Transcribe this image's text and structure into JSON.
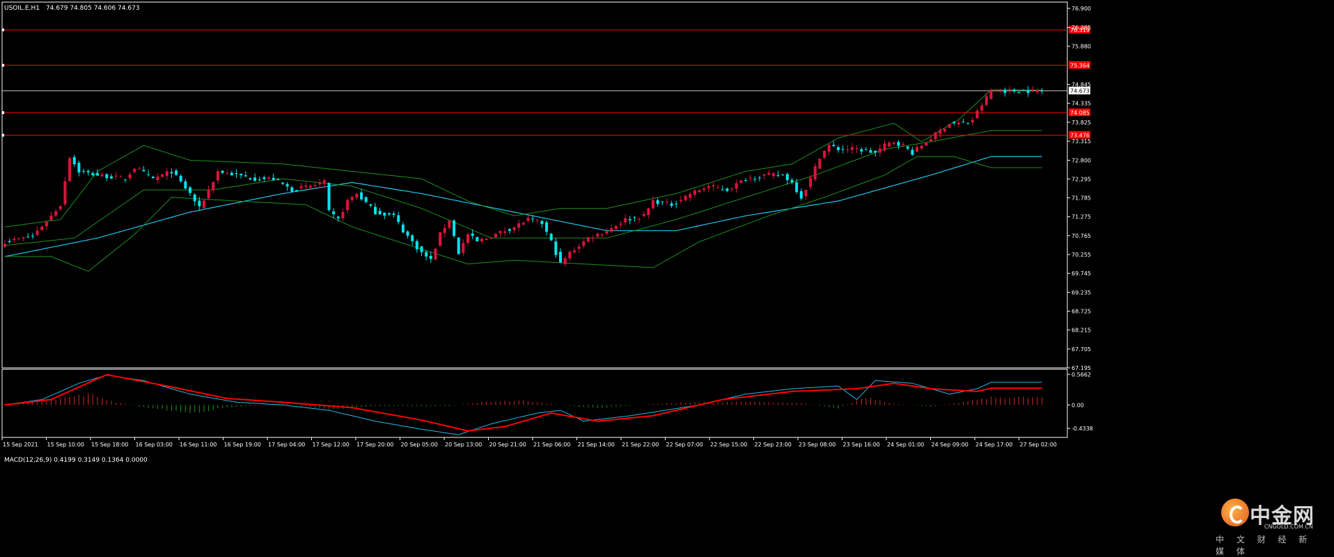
{
  "header": {
    "title": "USOIL.E,H1",
    "ohlc": "74.679 74.805 74.606 74.673"
  },
  "macd_label": "MACD(12,26,9) 0.4199 0.3149 0.1364 0.0000",
  "watermark": {
    "brand": "中金网",
    "site": "CNGOLD.COM.CN",
    "slogan": "中 文 财 经 新 媒 体"
  },
  "colors": {
    "background": "#000000",
    "frame": "#ffffff",
    "bull": "#dc143c",
    "bear": "#00e5ee",
    "bands": "#1f8f1f",
    "ma": "#22c5f0",
    "level_line": "#ff0000",
    "current_line": "#c0c0c0",
    "macd_main": "#25b9e8",
    "macd_signal": "#ff0000",
    "hist_pos": "#b22222",
    "hist_neg": "#1b7a1b"
  },
  "chart_data": {
    "type": "candlestick",
    "symbol": "USOIL.E",
    "timeframe": "H1",
    "price_axis_labels": [
      "76.900",
      "76.385",
      "75.880",
      "75.364",
      "74.845",
      "74.673",
      "74.335",
      "73.825",
      "73.315",
      "72.800",
      "72.295",
      "71.785",
      "71.275",
      "70.765",
      "70.255",
      "69.745",
      "69.235",
      "68.725",
      "68.215",
      "67.705",
      "67.195"
    ],
    "ylim": [
      67.195,
      77.07
    ],
    "level_lines": [
      {
        "label": "76.319",
        "value": 76.319
      },
      {
        "label": "75.364",
        "value": 75.364
      },
      {
        "label": "74.085",
        "value": 74.085
      },
      {
        "label": "73.476",
        "value": 73.476
      }
    ],
    "current_price": {
      "label": "74.673",
      "value": 74.673
    },
    "time_axis_labels": [
      "15 Sep 2021",
      "15 Sep 10:00",
      "15 Sep 18:00",
      "16 Sep 03:00",
      "16 Sep 11:00",
      "16 Sep 19:00",
      "17 Sep 04:00",
      "17 Sep 12:00",
      "17 Sep 20:00",
      "20 Sep 05:00",
      "20 Sep 13:00",
      "20 Sep 21:00",
      "21 Sep 06:00",
      "21 Sep 14:00",
      "21 Sep 22:00",
      "22 Sep 07:00",
      "22 Sep 15:00",
      "22 Sep 23:00",
      "23 Sep 08:00",
      "23 Sep 16:00",
      "24 Sep 01:00",
      "24 Sep 09:00",
      "24 Sep 17:00",
      "27 Sep 02:00"
    ],
    "close_anchors": [
      [
        0,
        70.6
      ],
      [
        6,
        70.75
      ],
      [
        10,
        71.3
      ],
      [
        12,
        71.6
      ],
      [
        14,
        72.9
      ],
      [
        16,
        72.5
      ],
      [
        20,
        72.4
      ],
      [
        26,
        72.3
      ],
      [
        28,
        72.6
      ],
      [
        32,
        72.3
      ],
      [
        36,
        72.5
      ],
      [
        40,
        71.9
      ],
      [
        42,
        71.5
      ],
      [
        44,
        72.0
      ],
      [
        46,
        72.5
      ],
      [
        50,
        72.4
      ],
      [
        54,
        72.3
      ],
      [
        58,
        72.3
      ],
      [
        62,
        72.0
      ],
      [
        66,
        72.1
      ],
      [
        69,
        72.2
      ],
      [
        70,
        71.4
      ],
      [
        72,
        71.2
      ],
      [
        74,
        71.7
      ],
      [
        76,
        71.9
      ],
      [
        80,
        71.4
      ],
      [
        84,
        71.3
      ],
      [
        86,
        70.9
      ],
      [
        88,
        70.6
      ],
      [
        90,
        70.3
      ],
      [
        92,
        70.1
      ],
      [
        94,
        70.8
      ],
      [
        96,
        71.2
      ],
      [
        98,
        70.3
      ],
      [
        100,
        70.8
      ],
      [
        102,
        70.6
      ],
      [
        104,
        70.7
      ],
      [
        108,
        70.9
      ],
      [
        110,
        71.0
      ],
      [
        113,
        71.2
      ],
      [
        116,
        71.1
      ],
      [
        118,
        70.6
      ],
      [
        120,
        70.0
      ],
      [
        122,
        70.3
      ],
      [
        126,
        70.7
      ],
      [
        130,
        70.9
      ],
      [
        134,
        71.2
      ],
      [
        138,
        71.3
      ],
      [
        140,
        71.7
      ],
      [
        144,
        71.6
      ],
      [
        148,
        71.9
      ],
      [
        152,
        72.1
      ],
      [
        156,
        72.0
      ],
      [
        160,
        72.3
      ],
      [
        164,
        72.4
      ],
      [
        168,
        72.4
      ],
      [
        170,
        72.2
      ],
      [
        172,
        71.8
      ],
      [
        174,
        72.3
      ],
      [
        176,
        72.9
      ],
      [
        178,
        73.2
      ],
      [
        180,
        73.1
      ],
      [
        184,
        73.1
      ],
      [
        188,
        73.0
      ],
      [
        190,
        73.2
      ],
      [
        192,
        73.3
      ],
      [
        194,
        73.2
      ],
      [
        196,
        73.0
      ],
      [
        200,
        73.4
      ],
      [
        204,
        73.8
      ],
      [
        208,
        73.8
      ],
      [
        209,
        73.9
      ],
      [
        211,
        74.3
      ],
      [
        213,
        74.673
      ]
    ],
    "price_series": [
      {
        "name": "MA",
        "anchors": [
          [
            0,
            70.2
          ],
          [
            20,
            70.7
          ],
          [
            40,
            71.4
          ],
          [
            60,
            71.9
          ],
          [
            75,
            72.2
          ],
          [
            90,
            71.9
          ],
          [
            110,
            71.4
          ],
          [
            130,
            70.9
          ],
          [
            145,
            70.9
          ],
          [
            160,
            71.3
          ],
          [
            180,
            71.7
          ],
          [
            200,
            72.4
          ],
          [
            213,
            72.9
          ]
        ]
      },
      {
        "name": "Upper band",
        "anchors": [
          [
            0,
            71.0
          ],
          [
            12,
            71.2
          ],
          [
            20,
            72.5
          ],
          [
            30,
            73.2
          ],
          [
            40,
            72.8
          ],
          [
            60,
            72.7
          ],
          [
            75,
            72.5
          ],
          [
            90,
            72.3
          ],
          [
            100,
            71.7
          ],
          [
            110,
            71.3
          ],
          [
            120,
            71.5
          ],
          [
            130,
            71.5
          ],
          [
            145,
            71.9
          ],
          [
            160,
            72.5
          ],
          [
            170,
            72.7
          ],
          [
            180,
            73.4
          ],
          [
            192,
            73.8
          ],
          [
            198,
            73.3
          ],
          [
            206,
            73.9
          ],
          [
            213,
            74.7
          ]
        ]
      },
      {
        "name": "Middle band",
        "anchors": [
          [
            0,
            70.5
          ],
          [
            15,
            70.7
          ],
          [
            30,
            72.0
          ],
          [
            45,
            72.0
          ],
          [
            60,
            72.3
          ],
          [
            75,
            72.1
          ],
          [
            90,
            71.5
          ],
          [
            105,
            70.7
          ],
          [
            115,
            70.7
          ],
          [
            130,
            70.7
          ],
          [
            145,
            71.2
          ],
          [
            160,
            71.8
          ],
          [
            175,
            72.4
          ],
          [
            190,
            73.1
          ],
          [
            200,
            73.3
          ],
          [
            213,
            73.6
          ]
        ]
      },
      {
        "name": "Lower band",
        "anchors": [
          [
            0,
            70.2
          ],
          [
            10,
            70.2
          ],
          [
            18,
            69.8
          ],
          [
            28,
            70.8
          ],
          [
            36,
            71.8
          ],
          [
            50,
            71.7
          ],
          [
            65,
            71.6
          ],
          [
            75,
            71.0
          ],
          [
            90,
            70.4
          ],
          [
            100,
            70.0
          ],
          [
            110,
            70.1
          ],
          [
            125,
            70.0
          ],
          [
            140,
            69.9
          ],
          [
            150,
            70.6
          ],
          [
            165,
            71.3
          ],
          [
            177,
            71.8
          ],
          [
            190,
            72.4
          ],
          [
            197,
            72.9
          ],
          [
            205,
            72.9
          ],
          [
            213,
            72.6
          ]
        ]
      }
    ],
    "macd": {
      "axis_labels": [
        "0.5662",
        "0.00",
        "-0.4338"
      ],
      "ylim": [
        -0.6,
        0.66
      ],
      "main_anchors": [
        [
          0,
          0.0
        ],
        [
          8,
          0.1
        ],
        [
          16,
          0.4
        ],
        [
          22,
          0.55
        ],
        [
          30,
          0.45
        ],
        [
          40,
          0.2
        ],
        [
          50,
          0.05
        ],
        [
          60,
          0.0
        ],
        [
          70,
          -0.1
        ],
        [
          80,
          -0.3
        ],
        [
          90,
          -0.45
        ],
        [
          98,
          -0.55
        ],
        [
          105,
          -0.35
        ],
        [
          115,
          -0.15
        ],
        [
          120,
          -0.1
        ],
        [
          125,
          -0.3
        ],
        [
          135,
          -0.2
        ],
        [
          150,
          0.0
        ],
        [
          160,
          0.2
        ],
        [
          170,
          0.3
        ],
        [
          180,
          0.35
        ],
        [
          184,
          0.1
        ],
        [
          188,
          0.45
        ],
        [
          196,
          0.4
        ],
        [
          204,
          0.2
        ],
        [
          210,
          0.3
        ],
        [
          213,
          0.42
        ]
      ],
      "signal_anchors": [
        [
          0,
          0.0
        ],
        [
          10,
          0.1
        ],
        [
          22,
          0.56
        ],
        [
          35,
          0.35
        ],
        [
          48,
          0.12
        ],
        [
          60,
          0.05
        ],
        [
          75,
          -0.05
        ],
        [
          90,
          -0.28
        ],
        [
          100,
          -0.48
        ],
        [
          108,
          -0.4
        ],
        [
          118,
          -0.15
        ],
        [
          128,
          -0.3
        ],
        [
          140,
          -0.2
        ],
        [
          155,
          0.1
        ],
        [
          170,
          0.25
        ],
        [
          184,
          0.3
        ],
        [
          192,
          0.4
        ],
        [
          200,
          0.3
        ],
        [
          210,
          0.25
        ],
        [
          213,
          0.31
        ]
      ],
      "histogram_anchors": [
        [
          0,
          0.02
        ],
        [
          10,
          0.1
        ],
        [
          18,
          0.2
        ],
        [
          24,
          0.05
        ],
        [
          30,
          -0.04
        ],
        [
          40,
          -0.15
        ],
        [
          48,
          -0.05
        ],
        [
          60,
          0.02
        ],
        [
          70,
          -0.08
        ],
        [
          80,
          -0.02
        ],
        [
          96,
          -0.02
        ],
        [
          104,
          0.06
        ],
        [
          112,
          0.08
        ],
        [
          120,
          0.0
        ],
        [
          128,
          -0.06
        ],
        [
          140,
          0.02
        ],
        [
          150,
          0.05
        ],
        [
          160,
          0.06
        ],
        [
          172,
          0.03
        ],
        [
          180,
          -0.06
        ],
        [
          186,
          0.15
        ],
        [
          192,
          0.02
        ],
        [
          200,
          -0.03
        ],
        [
          206,
          0.04
        ],
        [
          213,
          0.14
        ]
      ]
    }
  }
}
